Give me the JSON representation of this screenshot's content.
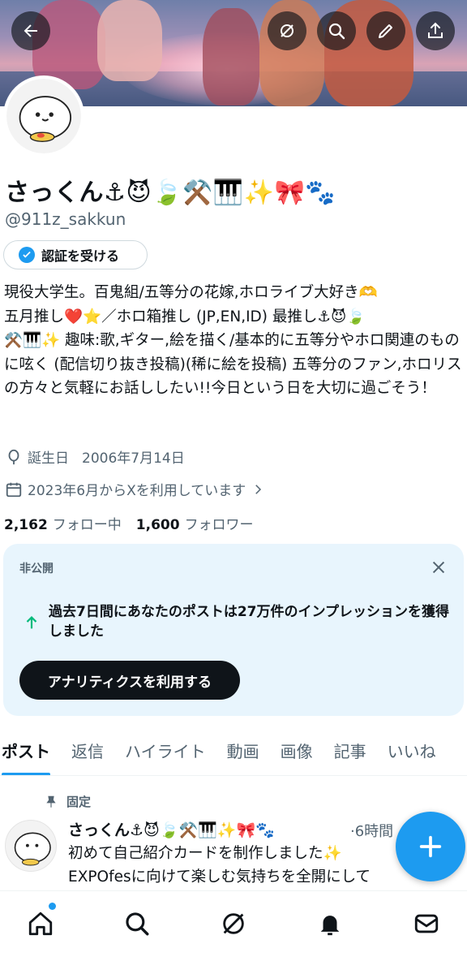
{
  "header": {
    "back_icon": "arrow-left-icon",
    "grok_icon": "grok-icon",
    "search_icon": "search-icon",
    "edit_icon": "pencil-icon",
    "share_icon": "share-icon"
  },
  "profile": {
    "display_name": "さっくん⚓😈🍃⚒️🎹✨🎀🐾",
    "handle": "@911z_sakkun",
    "verify_label": "認証を受ける",
    "bio": "現役大学生。百鬼組/五等分の花嫁,ホロライブ大好き🫶\n五月推し❤️⭐／ホロ箱推し (JP,EN,ID) 最推し⚓😈🍃\n⚒️🎹✨ 趣味:歌,ギター,絵を描く/基本的に五等分やホロ関連のものに呟く (配信切り抜き投稿)(稀に絵を投稿) 五等分のファン,ホロリスの方々と気軽にお話ししたい!!今日という日を大切に過ごそう！",
    "birthday_label": "誕生日",
    "birthday_value": "2006年7月14日",
    "joined": "2023年6月からXを利用しています",
    "following_count": "2,162",
    "following_label": "フォロー中",
    "followers_count": "1,600",
    "followers_label": "フォロワー"
  },
  "private_card": {
    "title": "非公開",
    "message": "過去7日間にあなたのポストは27万件のインプレッションを獲得しました",
    "button": "アナリティクスを利用する"
  },
  "tabs": [
    "ポスト",
    "返信",
    "ハイライト",
    "動画",
    "画像",
    "記事",
    "いいね"
  ],
  "pinned_post": {
    "pinned_label": "固定",
    "author": "さっくん⚓😈🍃⚒️🎹✨🎀🐾",
    "time": "·6時間",
    "text": "初めて自己紹介カードを制作しました✨\nEXPOfesに向けて楽しむ気持ちを全開にして"
  },
  "bottom_nav": [
    "home-icon",
    "search-icon",
    "grok-icon",
    "notifications-icon",
    "messages-icon"
  ],
  "colors": {
    "accent": "#1d9bf0",
    "text": "#0f1419",
    "muted": "#536471",
    "card_bg": "#e8f5fd"
  }
}
